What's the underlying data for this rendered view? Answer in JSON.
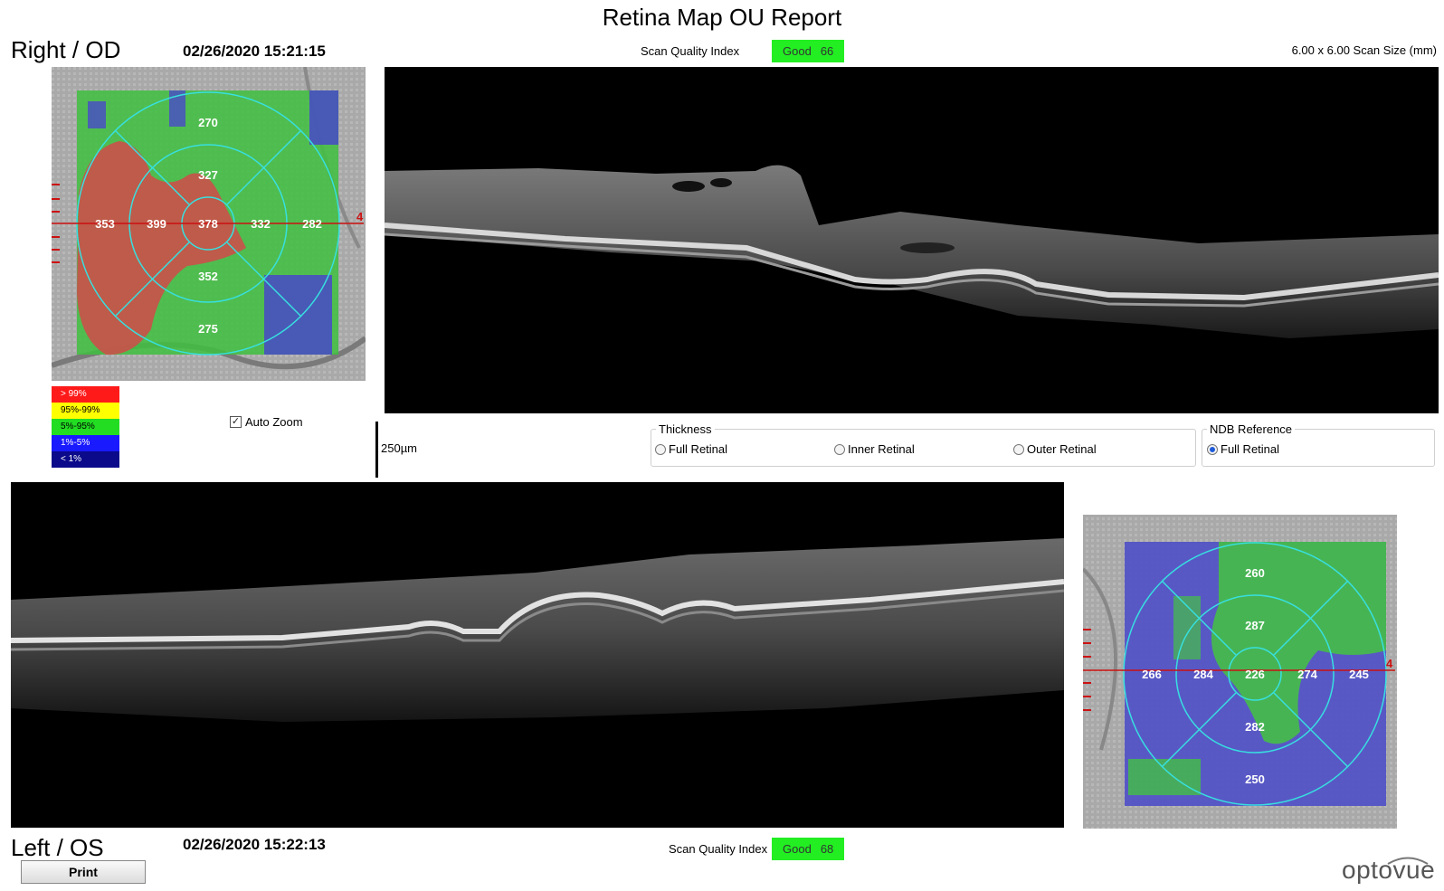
{
  "report": {
    "title": "Retina Map OU Report"
  },
  "right_eye": {
    "label": "Right / OD",
    "datetime": "02/26/2020 15:21:15",
    "scan_quality": {
      "label": "Scan Quality Index",
      "rating": "Good",
      "value": "66",
      "color": "#22ee22"
    },
    "scan_size": "6.00 x 6.00 Scan Size (mm)",
    "sectors": {
      "superior_outer": "270",
      "superior_inner": "327",
      "nasal_outer": "353",
      "nasal_inner": "399",
      "center": "378",
      "temporal_inner": "332",
      "temporal_outer": "282",
      "inferior_inner": "352",
      "inferior_outer": "275"
    },
    "scan_marker": "4"
  },
  "left_eye": {
    "label": "Left / OS",
    "datetime": "02/26/2020 15:22:13",
    "scan_quality": {
      "label": "Scan Quality Index",
      "rating": "Good",
      "value": "68",
      "color": "#22ee22"
    },
    "sectors": {
      "superior_outer": "260",
      "superior_inner": "287",
      "nasal_outer": "266",
      "nasal_inner": "284",
      "center": "226",
      "temporal_inner": "274",
      "temporal_outer": "245",
      "inferior_inner": "282",
      "inferior_outer": "250"
    },
    "scan_marker": "4"
  },
  "legend": [
    {
      "label": "> 99%",
      "color": "#ff1a1a"
    },
    {
      "label": "95%-99%",
      "color": "#ffff00"
    },
    {
      "label": "5%-95%",
      "color": "#22dd22"
    },
    {
      "label": "1%-5%",
      "color": "#1a1aff"
    },
    {
      "label": "< 1%",
      "color": "#0a0a8a"
    }
  ],
  "controls": {
    "auto_zoom": {
      "label": "Auto Zoom",
      "checked": true
    },
    "scale_bar": "250µm",
    "thickness": {
      "title": "Thickness",
      "options": [
        "Full Retinal",
        "Inner Retinal",
        "Outer Retinal"
      ],
      "selected": null
    },
    "ndb_reference": {
      "title": "NDB Reference",
      "options": [
        "Full Retinal"
      ],
      "selected": "Full Retinal"
    },
    "print_label": "Print"
  },
  "brand": {
    "name": "optovue"
  }
}
